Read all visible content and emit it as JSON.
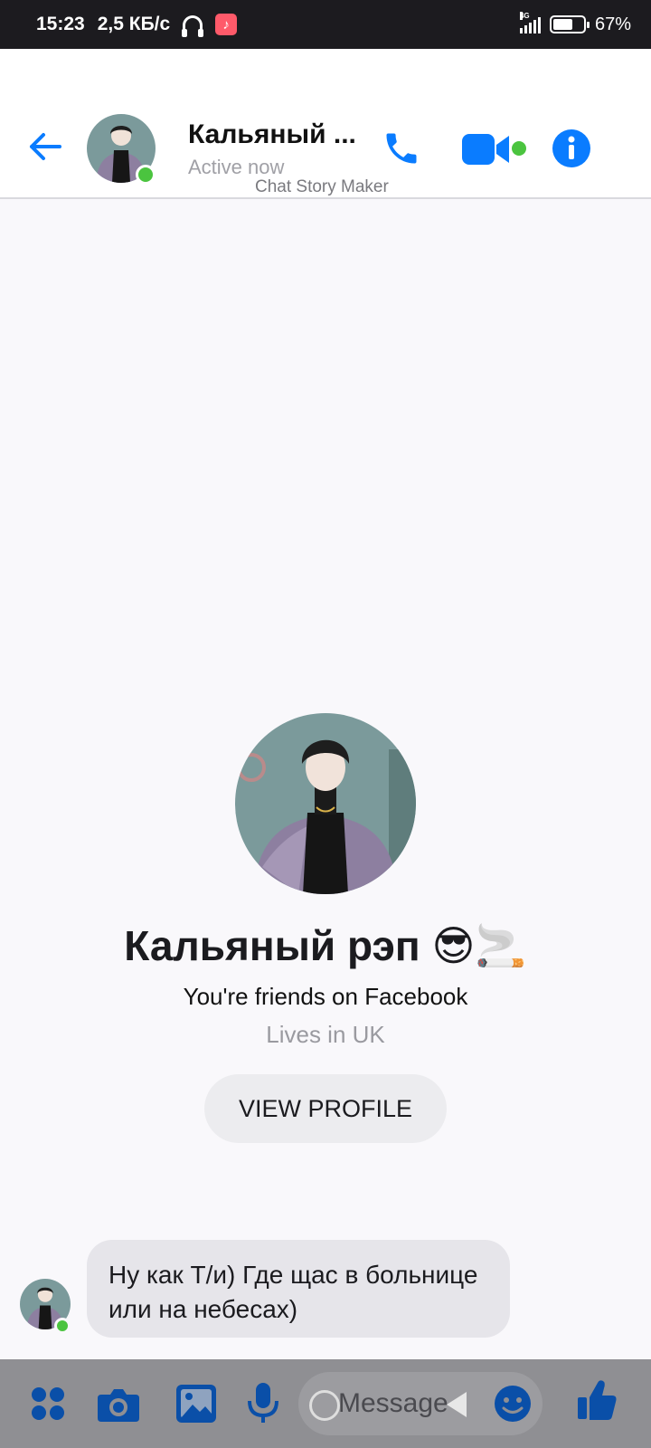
{
  "status_bar": {
    "time": "15:23",
    "speed": "2,5 КБ/с",
    "network": "4G",
    "battery": "67%",
    "battery_level": 0.67,
    "icons": [
      "headphones-icon",
      "tiktok-icon",
      "signal-icon",
      "battery-icon"
    ]
  },
  "header": {
    "contact_name": "Кальяный ...",
    "status": "Active now",
    "watermark": "Chat Story Maker",
    "icons": [
      "back-arrow-icon",
      "phone-icon",
      "video-camera-icon",
      "info-icon"
    ]
  },
  "profile": {
    "name": "Кальяный рэп 😎🚬",
    "friends_text": "You're friends on Facebook",
    "location_text": "Lives in UK",
    "view_profile_label": "VIEW PROFILE"
  },
  "messages": [
    {
      "sender": "incoming",
      "text": "Ну как Т/и) Где щас в больнице или на небесах)"
    }
  ],
  "composer": {
    "placeholder": "Message",
    "icons": [
      "apps-grid-icon",
      "camera-icon",
      "gallery-icon",
      "microphone-icon",
      "emoji-icon",
      "thumbs-up-icon"
    ]
  },
  "colors": {
    "accent": "#0a7cff",
    "online": "#4bc43f",
    "bubble": "#e6e5ea"
  }
}
